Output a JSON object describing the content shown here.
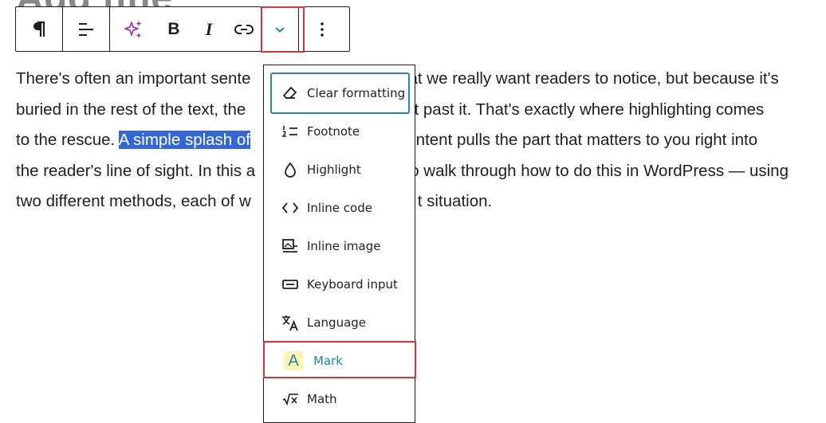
{
  "editor": {
    "ghost_title": "Add title"
  },
  "toolbar": {
    "buttons": [
      {
        "name": "paragraph",
        "icon": "pilcrow-icon"
      },
      {
        "name": "align",
        "icon": "align-left-icon"
      },
      {
        "name": "ai-sparkle",
        "icon": "sparkle-icon"
      },
      {
        "name": "bold",
        "label": "B"
      },
      {
        "name": "italic",
        "label": "I"
      },
      {
        "name": "link",
        "icon": "link-icon"
      },
      {
        "name": "more-rich-text",
        "icon": "chevron-down-icon"
      },
      {
        "name": "options",
        "icon": "more-vertical-icon"
      }
    ],
    "bold_label": "B",
    "italic_label": "I"
  },
  "paragraph": {
    "line1": "There's often an important sente",
    "line1_b": "at we really want readers to notice, but because it's",
    "line2": "buried in the rest of the text, the",
    "line2_b": "right past it. That's exactly where highlighting comes",
    "line3_a": "to the rescue. ",
    "line3_sel": "A simple splash of",
    "line3_b": "content pulls the part that matters to you right into",
    "line4": "the reader's line of sight. In this a",
    "line4_b": "o walk through how to do this in WordPress — using",
    "line5": "two different methods, each of w",
    "line5_b": "t situation."
  },
  "dropdown": {
    "items": [
      {
        "label": "Clear formatting",
        "icon": "eraser-icon"
      },
      {
        "label": "Footnote",
        "icon": "footnote-icon"
      },
      {
        "label": "Highlight",
        "icon": "droplet-icon"
      },
      {
        "label": "Inline code",
        "icon": "code-icon"
      },
      {
        "label": "Inline image",
        "icon": "image-icon"
      },
      {
        "label": "Keyboard input",
        "icon": "keyboard-icon"
      },
      {
        "label": "Language",
        "icon": "language-icon"
      },
      {
        "label": "Mark",
        "icon": "mark-icon",
        "icon_text": "A"
      },
      {
        "label": "Math",
        "icon": "math-icon"
      }
    ]
  },
  "colors": {
    "selection": "#3367d6",
    "annotation_red": "#d63638",
    "focus_blue": "#2d7fbd",
    "mark_blue": "#1e84b8",
    "mark_bg": "#fff6b0",
    "sparkle_purple": "#9b3bb5"
  }
}
